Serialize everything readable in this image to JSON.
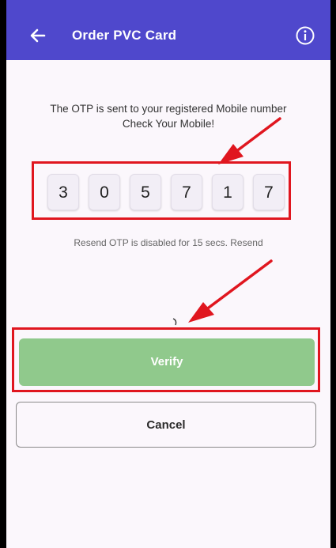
{
  "app_bar": {
    "title": "Order PVC Card",
    "back_icon": "arrow-left-icon",
    "info_icon": "info-icon",
    "color": "#4f48cc"
  },
  "otp": {
    "message_line1": "The OTP is sent to your registered Mobile number",
    "message_line2": "Check Your Mobile!",
    "digits": [
      "3",
      "0",
      "5",
      "7",
      "1",
      "7"
    ],
    "resend_text": "Resend OTP is disabled for 15 secs.",
    "resend_link": "Resend"
  },
  "actions": {
    "verify_label": "Verify",
    "cancel_label": "Cancel",
    "verify_color": "#90c98c"
  },
  "annotations": {
    "highlight_color": "#e0161f"
  }
}
